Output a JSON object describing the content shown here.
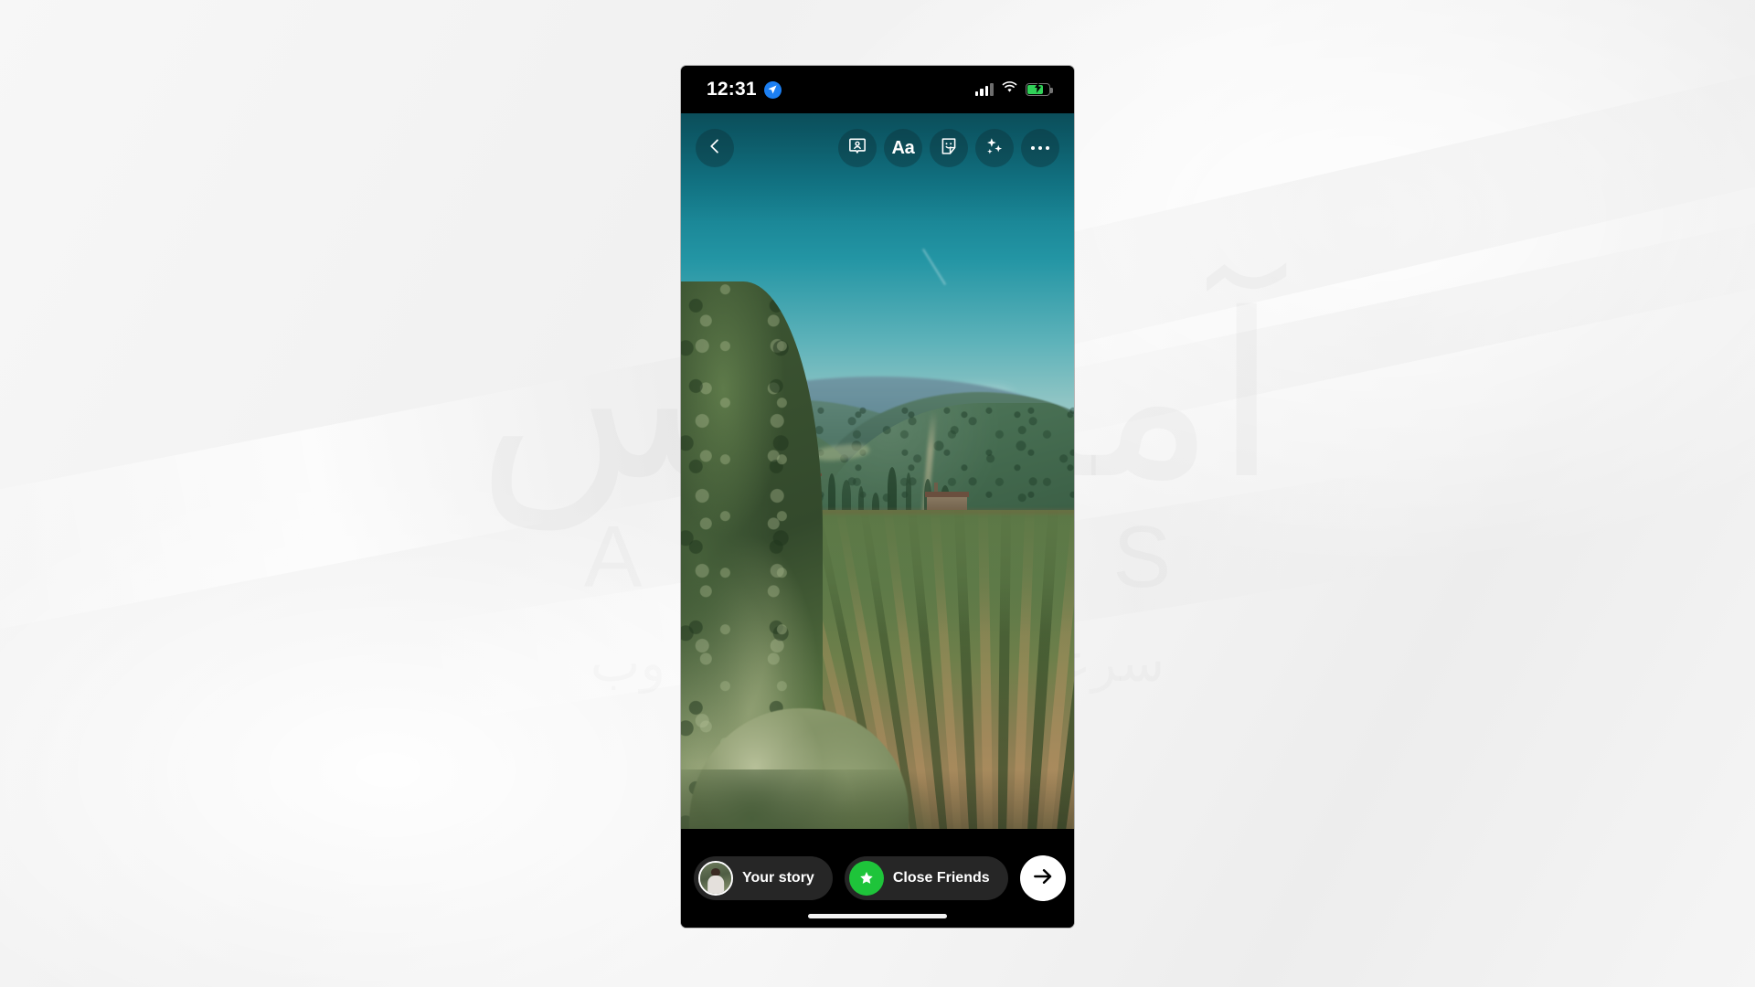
{
  "background": {
    "watermark_main": "آماسیس",
    "watermark_latin": "AMASIS",
    "watermark_sub": "سرعت معنای میزبانی وب",
    "page_bg": "#f4f4f4"
  },
  "phone": {
    "statusbar": {
      "time": "12:31",
      "location_icon": "location-arrow-icon",
      "location_badge_color": "#1c7ff2",
      "signal_icon": "cellular-signal-icon",
      "signal_bars_filled": 3,
      "signal_bars_total": 4,
      "wifi_icon": "wifi-icon",
      "battery_icon": "battery-charging-icon",
      "battery_color": "#30d158",
      "battery_level_percent": 76
    },
    "toolbar": {
      "back": {
        "label": "Back",
        "icon": "chevron-left-icon"
      },
      "actions": [
        {
          "label": "Tag people",
          "icon": "tag-people-icon"
        },
        {
          "label": "Aa",
          "icon": "text-tool-icon"
        },
        {
          "label": "Sticker",
          "icon": "sticker-icon"
        },
        {
          "label": "Effects",
          "icon": "sparkles-icon"
        },
        {
          "label": "More",
          "icon": "ellipsis-icon"
        }
      ]
    },
    "story": {
      "media_type": "photo",
      "description": "Tuscan vineyard landscape with rolling wooded hills, cypress trees, a stone villa and converging rows of vines on reddish soil"
    },
    "actionbar": {
      "your_story": {
        "label": "Your story",
        "avatar": "user-avatar"
      },
      "close_friends": {
        "label": "Close Friends",
        "badge_icon": "close-friends-star-icon",
        "badge_color": "#1ec43a"
      },
      "send": {
        "label": "Send",
        "icon": "arrow-right-icon"
      }
    },
    "home_indicator": "home-indicator"
  }
}
